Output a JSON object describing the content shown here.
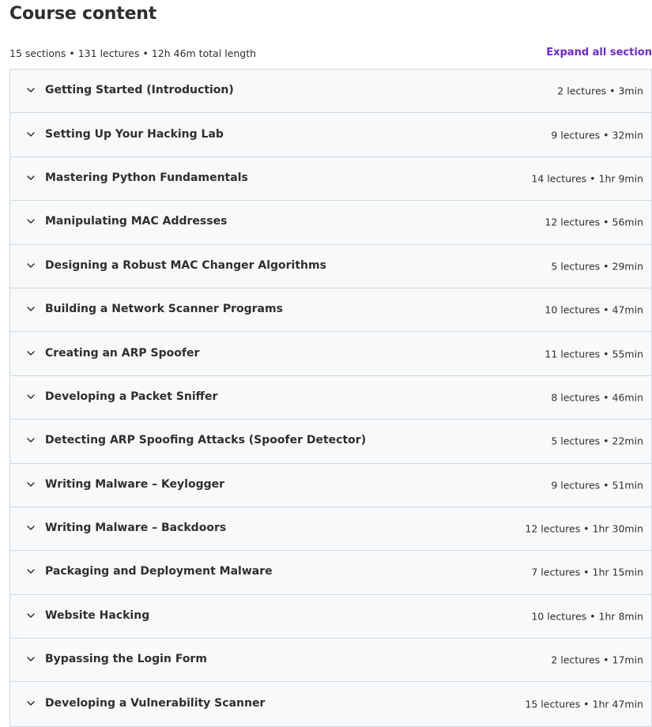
{
  "header": {
    "title": "Course content",
    "summary": "15 sections • 131 lectures • 12h 46m total length",
    "expand_all_label": "Expand all section"
  },
  "icons": {
    "section_toggle": "chevron-down-icon"
  },
  "colors": {
    "accent": "#6d28d2",
    "section_bg": "#f7f9fa",
    "border": "#d1d7dc",
    "text": "#2d2f31"
  },
  "sections": [
    {
      "title": "Getting Started (Introduction)",
      "meta": "2 lectures • 3min"
    },
    {
      "title": "Setting Up Your Hacking Lab",
      "meta": "9 lectures • 32min"
    },
    {
      "title": "Mastering Python Fundamentals",
      "meta": "14 lectures • 1hr 9min"
    },
    {
      "title": "Manipulating MAC Addresses",
      "meta": "12 lectures • 56min"
    },
    {
      "title": "Designing a Robust MAC Changer Algorithms",
      "meta": "5 lectures • 29min"
    },
    {
      "title": "Building a Network Scanner Programs",
      "meta": "10 lectures • 47min"
    },
    {
      "title": "Creating an ARP Spoofer",
      "meta": "11 lectures • 55min"
    },
    {
      "title": "Developing a Packet Sniffer",
      "meta": "8 lectures • 46min"
    },
    {
      "title": "Detecting ARP Spoofing Attacks (Spoofer Detector)",
      "meta": "5 lectures • 22min"
    },
    {
      "title": "Writing Malware – Keylogger",
      "meta": "9 lectures • 51min"
    },
    {
      "title": "Writing Malware – Backdoors",
      "meta": "12 lectures • 1hr 30min"
    },
    {
      "title": "Packaging and Deployment Malware",
      "meta": "7 lectures • 1hr 15min"
    },
    {
      "title": "Website Hacking",
      "meta": "10 lectures • 1hr 8min"
    },
    {
      "title": "Bypassing the Login Form",
      "meta": "2 lectures • 17min"
    },
    {
      "title": "Developing a Vulnerability Scanner",
      "meta": "15 lectures • 1hr 47min"
    }
  ]
}
